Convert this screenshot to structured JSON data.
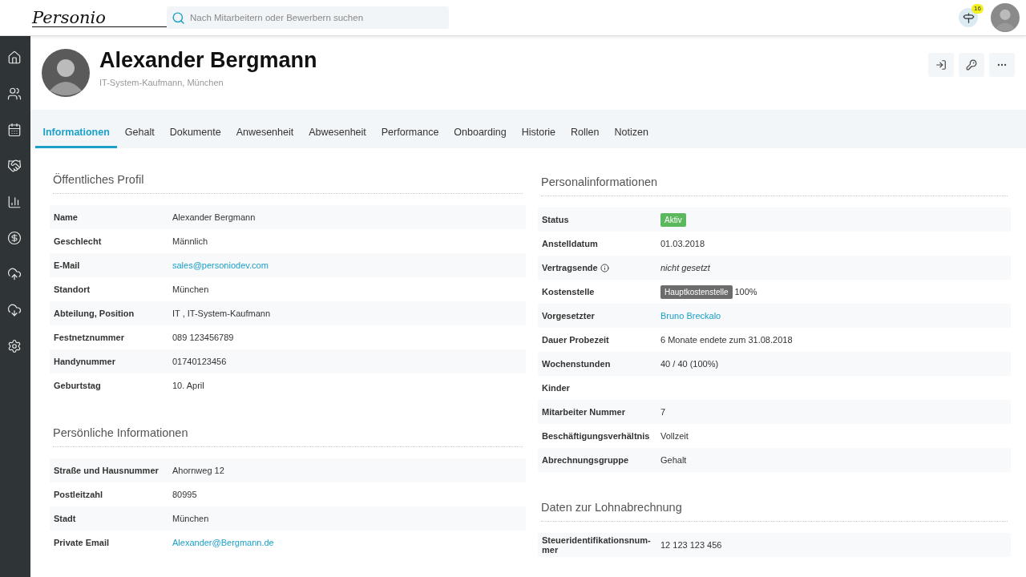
{
  "brand": "Personio",
  "search": {
    "placeholder": "Nach Mitarbeitern oder Bewerbern suchen"
  },
  "notifications": {
    "count": "16"
  },
  "profile": {
    "name": "Alexander Bergmann",
    "subtitle": "IT-System-Kaufmann, München"
  },
  "tabs": [
    {
      "label": "Informationen",
      "selected": true
    },
    {
      "label": "Gehalt",
      "selected": false
    },
    {
      "label": "Dokumente",
      "selected": false
    },
    {
      "label": "Anwesenheit",
      "selected": false
    },
    {
      "label": "Abwesenheit",
      "selected": false
    },
    {
      "label": "Performance",
      "selected": false
    },
    {
      "label": "Onboarding",
      "selected": false
    },
    {
      "label": "Historie",
      "selected": false
    },
    {
      "label": "Rollen",
      "selected": false
    },
    {
      "label": "Notizen",
      "selected": false
    }
  ],
  "columns": [
    {
      "sections": [
        {
          "title": "Öffentliches Profil",
          "rows": [
            {
              "label": "Name",
              "kind": "text",
              "value": "Alexander Bergmann"
            },
            {
              "label": "Geschlecht",
              "kind": "text",
              "value": "Männlich"
            },
            {
              "label": "E-Mail",
              "kind": "link",
              "value": "sales@personiodev.com"
            },
            {
              "label": "Standort",
              "kind": "text",
              "value": "München"
            },
            {
              "label": "Abteilung, Position",
              "kind": "text",
              "value": "IT , IT-System-Kaufmann"
            },
            {
              "label": "Festnetznummer",
              "kind": "text",
              "value": "089 123456789"
            },
            {
              "label": "Handynummer",
              "kind": "text",
              "value": "01740123456"
            },
            {
              "label": "Geburtstag",
              "kind": "text",
              "value": "10. April"
            }
          ]
        },
        {
          "title": "Persönliche Informationen",
          "rows": [
            {
              "label": "Straße und Hausnummer",
              "kind": "text",
              "value": "Ahornweg 12"
            },
            {
              "label": "Postleitzahl",
              "kind": "text",
              "value": "80995"
            },
            {
              "label": "Stadt",
              "kind": "text",
              "value": "München"
            },
            {
              "label": "Private Email",
              "kind": "link",
              "value": "Alexander@Bergmann.de"
            }
          ]
        }
      ]
    },
    {
      "sections": [
        {
          "title": "Personalinformationen",
          "rows": [
            {
              "label": "Status",
              "kind": "status",
              "value": "Aktiv"
            },
            {
              "label": "Anstelldatum",
              "kind": "text",
              "value": "01.03.2018"
            },
            {
              "label": "Vertragsende",
              "kind": "italic",
              "info": true,
              "value": "nicht gesetzt"
            },
            {
              "label": "Kostenstelle",
              "kind": "cost",
              "tag": "Hauptkostenstelle",
              "value": "100%"
            },
            {
              "label": "Vorgesetzter",
              "kind": "link",
              "value": "Bruno Breckalo"
            },
            {
              "label": "Dauer Probezeit",
              "kind": "text",
              "value": "6 Monate endete zum 31.08.2018"
            },
            {
              "label": "Wochenstunden",
              "kind": "text",
              "value": "40 / 40 (100%)"
            },
            {
              "label": "Kinder",
              "kind": "text"
            },
            {
              "label": "Mitarbeiter Nummer",
              "kind": "text",
              "value": "7"
            },
            {
              "label": "Beschäftigungsverhältnis",
              "kind": "text",
              "value": "Vollzeit"
            },
            {
              "label": "Abrechnungsgruppe",
              "kind": "text",
              "value": "Gehalt"
            }
          ]
        },
        {
          "title": "Daten zur Lohnabrechnung",
          "rows": [
            {
              "label": "Steueridentifikationsnum-mer",
              "kind": "text",
              "value": "12 123 123 456"
            }
          ]
        }
      ]
    }
  ]
}
